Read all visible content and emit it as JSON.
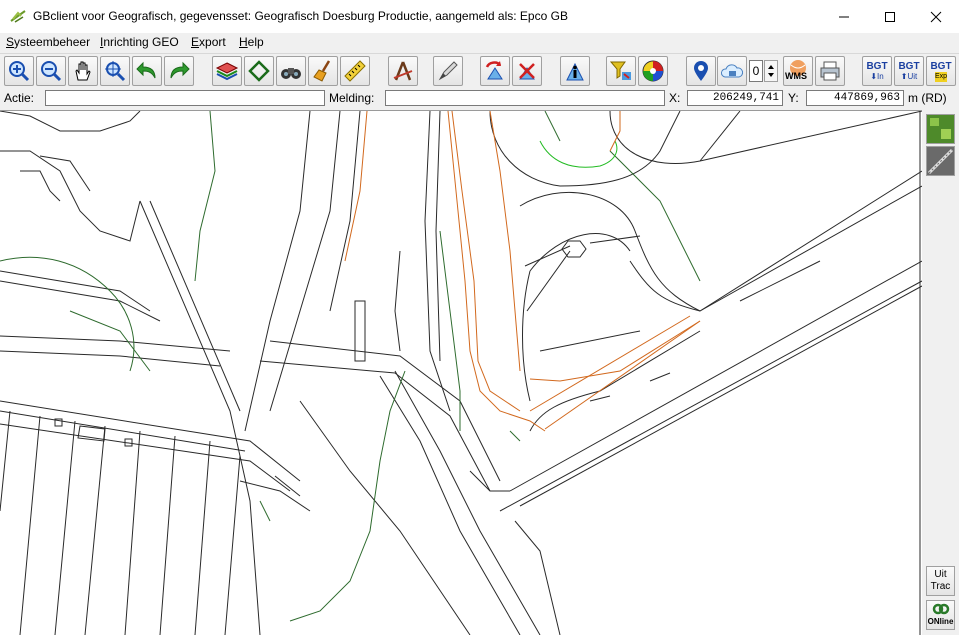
{
  "window": {
    "title": "GBclient voor Geografisch, gegevensset: Geografisch Doesburg Productie, aangemeld als: Epco GB"
  },
  "menu": [
    {
      "label": "Systeembeheer",
      "mnemonic": "S"
    },
    {
      "label": "Inrichting GEO",
      "mnemonic": "I"
    },
    {
      "label": "Export",
      "mnemonic": "E"
    },
    {
      "label": "Help",
      "mnemonic": "H"
    }
  ],
  "toolbar": {
    "spinner_value": "0",
    "wms_label": "WMS",
    "bgt_in": {
      "top": "BGT",
      "bottom": "In"
    },
    "bgt_uit": {
      "top": "BGT",
      "bottom": "Uit"
    },
    "bgt_exp": {
      "top": "BGT",
      "bottom": "Exp"
    }
  },
  "status": {
    "actie_label": "Actie:",
    "actie_value": "",
    "melding_label": "Melding:",
    "melding_value": "",
    "x_label": "X:",
    "x_value": "206249,741",
    "y_label": "Y:",
    "y_value": "447869,963",
    "unit": "m (RD)"
  },
  "side": {
    "uit_trac_line1": "Uit",
    "uit_trac_line2": "Trac",
    "online_label": "ONline"
  },
  "colors": {
    "line": "#2a2a2a",
    "green": "#2e6b2e",
    "bright_green": "#22bb22",
    "orange": "#d2691e"
  }
}
